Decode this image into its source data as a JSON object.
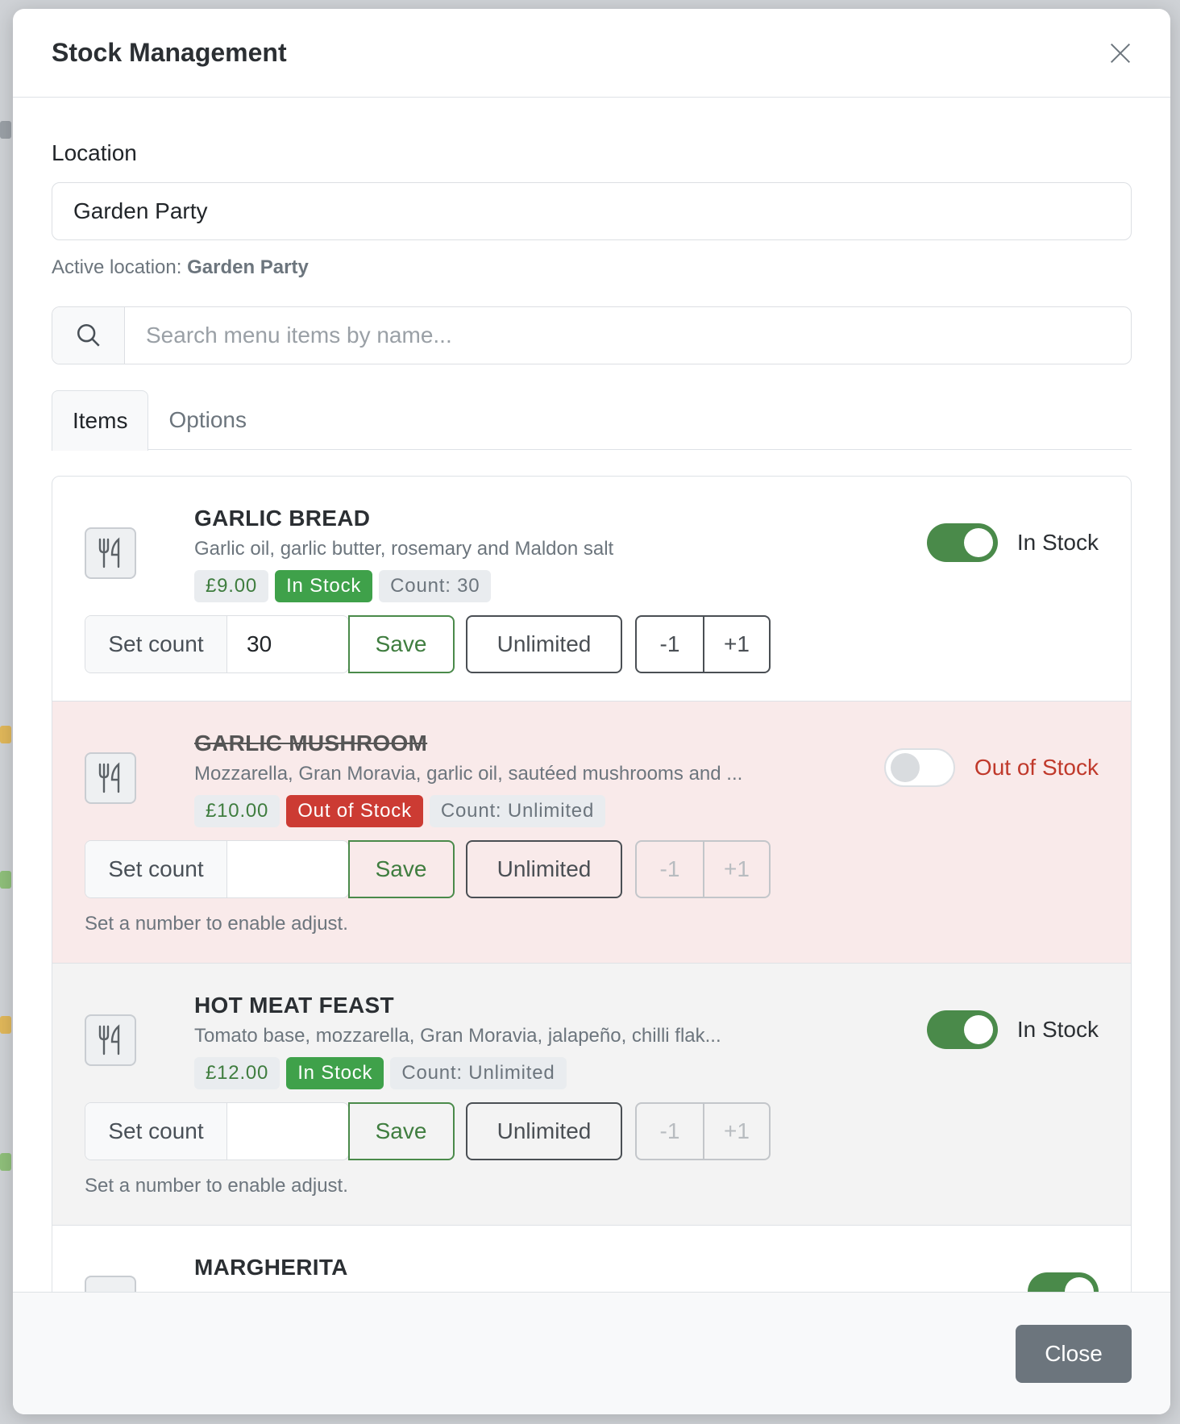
{
  "modal": {
    "title": "Stock Management",
    "close_label": "Close"
  },
  "location": {
    "label": "Location",
    "value": "Garden Party",
    "active_prefix": "Active location:",
    "active_value": "Garden Party"
  },
  "search": {
    "placeholder": "Search menu items by name..."
  },
  "tabs": [
    {
      "label": "Items",
      "active": true
    },
    {
      "label": "Options",
      "active": false
    }
  ],
  "items": [
    {
      "name": "GARLIC BREAD",
      "description": "Garlic oil, garlic butter, rosemary and Maldon salt",
      "price": "£9.00",
      "status": "In Stock",
      "count": "Count: 30",
      "set_count_label": "Set count",
      "count_value": "30",
      "save_label": "Save",
      "unlimited_label": "Unlimited",
      "minus_label": "-1",
      "plus_label": "+1",
      "toggle_label": "In Stock",
      "toggle_on": true
    },
    {
      "name": "GARLIC MUSHROOM",
      "description": "Mozzarella, Gran Moravia, garlic oil, sautéed mushrooms and ...",
      "price": "£10.00",
      "status": "Out of Stock",
      "count": "Count: Unlimited",
      "set_count_label": "Set count",
      "count_value": "",
      "save_label": "Save",
      "unlimited_label": "Unlimited",
      "minus_label": "-1",
      "plus_label": "+1",
      "hint": "Set a number to enable adjust.",
      "toggle_label": "Out of Stock",
      "toggle_on": false
    },
    {
      "name": "HOT MEAT FEAST",
      "description": "Tomato base, mozzarella, Gran Moravia, jalapeño, chilli flak...",
      "price": "£12.00",
      "status": "In Stock",
      "count": "Count: Unlimited",
      "set_count_label": "Set count",
      "count_value": "",
      "save_label": "Save",
      "unlimited_label": "Unlimited",
      "minus_label": "-1",
      "plus_label": "+1",
      "hint": "Set a number to enable adjust.",
      "toggle_label": "In Stock",
      "toggle_on": true
    },
    {
      "name": "MARGHERITA"
    }
  ],
  "colors": {
    "success": "#3fa14a",
    "toggle_on": "#4a8a4a",
    "danger": "#cc3b33",
    "oos_row_bg": "#f9eaea",
    "close_button": "#6c757d"
  },
  "icons": {
    "close": "close-icon",
    "search": "search-icon",
    "item": "utensils-icon"
  }
}
